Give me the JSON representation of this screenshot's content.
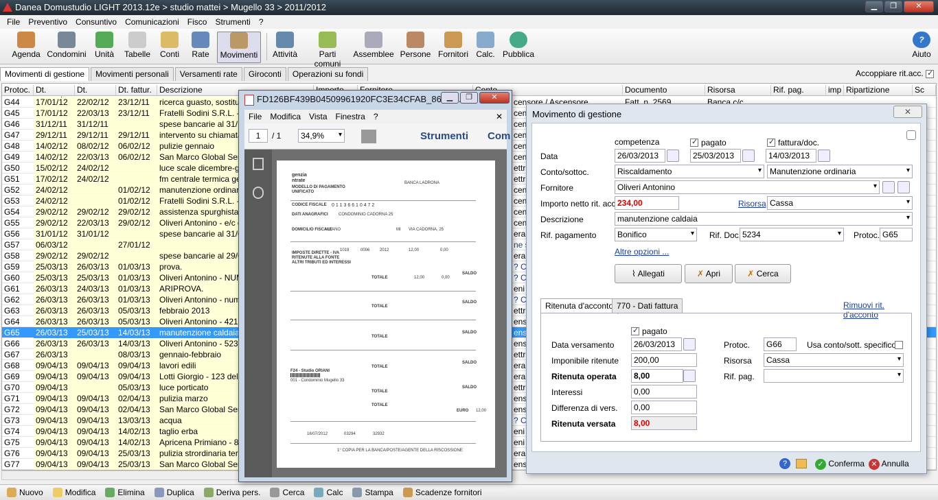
{
  "window": {
    "title": "Danea Domustudio LIGHT 2013.12e > studio mattei > Mugello 33 > 2011/2012",
    "min": "▁",
    "max": "❐",
    "close": "✕"
  },
  "menu": [
    "File",
    "Preventivo",
    "Consuntivo",
    "Comunicazioni",
    "Fisco",
    "Strumenti",
    "?"
  ],
  "toolbar": [
    "Agenda",
    "Condomini",
    "Unità",
    "Tabelle",
    "Conti",
    "Rate",
    "Movimenti",
    "Attività",
    "Parti comuni",
    "Assemblee",
    "Persone",
    "Fornitori",
    "Calc.",
    "Pubblica",
    "Aiuto"
  ],
  "tabs": [
    "Movimenti di gestione",
    "Movimenti personali",
    "Versamenti rate",
    "Giroconti",
    "Operazioni su fondi"
  ],
  "accoppiare": "Accoppiare rit.acc.",
  "grid": {
    "headers": [
      "Protoc.",
      "Dt. compet.",
      "Dt. pagam.",
      "Dt. fattur.",
      "Descrizione",
      "Importo",
      "Fornitore",
      "Conto",
      "Documento",
      "Risorsa",
      "Rif. pag.",
      "imp",
      "Ripartizione",
      "Sc"
    ],
    "rows": [
      [
        "G44",
        "17/01/12",
        "22/02/12",
        "23/12/11",
        "ricerca guasto, sostituito",
        "censore / Ascensore",
        "Fatt. n. 2569",
        "Banca c/c"
      ],
      [
        "G45",
        "17/01/12",
        "22/03/13",
        "23/12/11",
        "Fratelli Sodini S.R.L. - Fa",
        "censi",
        "",
        ""
      ],
      [
        "G46",
        "31/12/11",
        "31/12/11",
        "",
        "spese bancarie al 31/12",
        "censi",
        "",
        ""
      ],
      [
        "G47",
        "29/12/11",
        "29/12/11",
        "29/12/11",
        "intervento su chiamata d",
        "censi",
        "",
        ""
      ],
      [
        "G48",
        "14/02/12",
        "08/02/12",
        "06/02/12",
        "pulizie gennaio",
        "censi",
        "",
        ""
      ],
      [
        "G49",
        "14/02/12",
        "22/03/13",
        "06/02/12",
        "San Marco Global Servic",
        "censi",
        "",
        ""
      ],
      [
        "G50",
        "15/02/12",
        "24/02/12",
        "",
        "luce scale dicembre-gen",
        "ettric",
        "",
        ""
      ],
      [
        "G51",
        "17/02/12",
        "24/02/12",
        "",
        "fm centrale termica genn",
        "ettric",
        "",
        ""
      ],
      [
        "G52",
        "24/02/12",
        "",
        "01/02/12",
        "manutenzione ordinaria,",
        "censi",
        "",
        ""
      ],
      [
        "G53",
        "24/02/12",
        "",
        "01/02/12",
        "Fratelli Sodini S.R.L. - Fa",
        "censi",
        "",
        ""
      ],
      [
        "G54",
        "29/02/12",
        "29/02/12",
        "29/02/12",
        "assistenza spurghista pe",
        "censi",
        "",
        ""
      ],
      [
        "G55",
        "29/02/12",
        "22/03/13",
        "29/02/12",
        "Oliveri Antonino - e/c de",
        "censi",
        "",
        ""
      ],
      [
        "G56",
        "31/01/12",
        "31/01/12",
        "",
        "spese bancarie al 31/01",
        "erali",
        "",
        ""
      ],
      [
        "G57",
        "06/03/12",
        "",
        "27/01/12",
        "",
        "ne sp",
        "",
        ""
      ],
      [
        "G58",
        "29/02/12",
        "29/02/12",
        "",
        "spese bancarie al 29/02",
        "erali",
        "",
        ""
      ],
      [
        "G59",
        "25/03/13",
        "26/03/13",
        "01/03/13",
        "prova.",
        "? Co",
        "",
        ""
      ],
      [
        "G60",
        "25/03/13",
        "25/03/13",
        "01/03/13",
        "Oliveri Antonino - NUME",
        "? Co",
        "",
        ""
      ],
      [
        "G61",
        "26/03/13",
        "24/03/13",
        "01/03/13",
        "ARIPROVA.",
        "eni /",
        "",
        ""
      ],
      [
        "G62",
        "26/03/13",
        "26/03/13",
        "01/03/13",
        "Oliveri Antonino - numero",
        "? Co",
        "",
        ""
      ],
      [
        "G63",
        "26/03/13",
        "26/03/13",
        "05/03/13",
        "febbraio 2013",
        "ettric",
        "",
        ""
      ],
      [
        "G64",
        "26/03/13",
        "26/03/13",
        "05/03/13",
        "Oliveri Antonino - 4215 d",
        "ensi",
        "",
        ""
      ],
      [
        "G65",
        "26/03/13",
        "25/03/13",
        "14/03/13",
        "manutenzione caldaia",
        "ensi",
        "",
        ""
      ],
      [
        "G66",
        "26/03/13",
        "26/03/13",
        "14/03/13",
        "Oliveri Antonino - 5234 d",
        "ensi",
        "",
        ""
      ],
      [
        "G67",
        "26/03/13",
        "",
        "08/03/13",
        "gennaio-febbraio",
        "ettric",
        "",
        ""
      ],
      [
        "G68",
        "09/04/13",
        "09/04/13",
        "09/04/13",
        "lavori edili",
        "erali",
        "",
        ""
      ],
      [
        "G69",
        "09/04/13",
        "09/04/13",
        "09/04/13",
        "Lotti Giorgio - 123 del 09",
        "erali",
        "",
        ""
      ],
      [
        "G70",
        "09/04/13",
        "",
        "05/03/13",
        "luce porticato",
        "ettric",
        "",
        ""
      ],
      [
        "G71",
        "09/04/13",
        "09/04/13",
        "02/04/13",
        "pulizia marzo",
        "ensi",
        "",
        ""
      ],
      [
        "G72",
        "09/04/13",
        "09/04/13",
        "02/04/13",
        "San Marco Global Servic",
        "ensi",
        "",
        ""
      ],
      [
        "G73",
        "09/04/13",
        "09/04/13",
        "13/03/13",
        "acqua",
        "? Co",
        "",
        ""
      ],
      [
        "G74",
        "09/04/13",
        "09/04/13",
        "14/02/13",
        "taglio erba",
        "eni /",
        "",
        ""
      ],
      [
        "G75",
        "09/04/13",
        "09/04/13",
        "14/02/13",
        "Apricena Primiano - 8524",
        "eni /",
        "",
        ""
      ],
      [
        "G76",
        "09/04/13",
        "09/04/13",
        "25/03/13",
        "pulizia strordinaria terraz",
        "erali",
        "",
        ""
      ],
      [
        "G77",
        "09/04/13",
        "09/04/13",
        "25/03/13",
        "San Marco Global Servic",
        "ensi",
        "",
        ""
      ]
    ]
  },
  "bottombar": [
    "Nuovo",
    "Modifica",
    "Elimina",
    "Duplica",
    "Deriva pers.",
    "Cerca",
    "Calc",
    "Stampa",
    "Scadenze fornitori"
  ],
  "pdf": {
    "title": "FD126BF439B04509961920FC3E34CFAB_865.P...",
    "menu": [
      "File",
      "Modifica",
      "Vista",
      "Finestra",
      "?"
    ],
    "page": "1",
    "pages": "/ 1",
    "zoom": "34,9%",
    "strumenti": "Strumenti",
    "com": "Com",
    "doc": {
      "agenzia": "genzia",
      "entrate": "ntrate",
      "modello": "MODELLO DI PAGAMENTO",
      "unificato": "UNIFICATO",
      "banca": "BANCA LADRONA",
      "cf_label": "CODICE FISCALE",
      "cf": "0 1 1 3 6 6 1 0 4 7 2",
      "anag": "DATI ANAGRAFICI",
      "cond": "CONDOMINIO CADORNA 25",
      "dom": "DOMICILIO FISCALE",
      "citta": "MILANO",
      "prov": "MI",
      "via": "VIA CADORNA, 25",
      "imposte": "IMPOSTE DIRETTE - IVA",
      "ritenute": "RITENUTE ALLA FONTE",
      "altri": "ALTRI TRIBUTI ED INTERESSI",
      "codtrib": "1019",
      "anno": "2012",
      "rif": "0006",
      "importo": "12,00",
      "zero": "0,00",
      "saldo": "SALDO",
      "totale": "TOTALE",
      "f24": "F24 - Studio ORIANI",
      "cond2": "001 - Condominio Mugello 33",
      "euro": "EURO",
      "copia": "1° COPIA PER LA BANCA/POSTE/AGENTE DELLA RISCOSSIONE",
      "data": "16/07/2012",
      "n1": "03294",
      "n2": "32932"
    }
  },
  "dialog": {
    "title": "Movimento di gestione",
    "close": "✕",
    "competenza": "competenza",
    "pagato": "pagato",
    "fattura": "fattura/doc.",
    "data_label": "Data",
    "data_comp": "26/03/2013",
    "data_pag": "25/03/2013",
    "data_fatt": "14/03/2013",
    "conto_label": "Conto/sottoc.",
    "conto": "Riscaldamento",
    "sottoconto": "Manutenzione ordinaria",
    "fornitore_label": "Fornitore",
    "fornitore": "Oliveri Antonino",
    "importo_label": "Importo netto rit. acc.",
    "importo": "234,00",
    "risorsa_link": "Risorsa",
    "risorsa": "Cassa",
    "descr_label": "Descrizione",
    "descr": "manutenzione caldaia",
    "rifpag_label": "Rif. pagamento",
    "rifpag": "Bonifico",
    "rifdoc_label": "Rif. Doc.",
    "rifdoc": "5234",
    "protoc_label": "Protoc.",
    "protoc": "G65",
    "altre": "Altre opzioni ...",
    "btn_allegati": "Allegati",
    "btn_apri": "Apri",
    "btn_cerca": "Cerca",
    "tab1": "Ritenuta d'acconto",
    "tab2": "770 - Dati fattura",
    "rimuovi": "Rimuovi rit. d'acconto",
    "rit": {
      "pagato": "pagato",
      "datavers_label": "Data versamento",
      "datavers": "26/03/2013",
      "protoc_label": "Protoc.",
      "protoc": "G66",
      "usa": "Usa conto/sott. specifico",
      "impon_label": "Imponibile ritenute",
      "impon": "200,00",
      "risorsa_label": "Risorsa",
      "risorsa": "Cassa",
      "operata_label": "Ritenuta operata",
      "operata": "8,00",
      "rifpag_label": "Rif. pag.",
      "interessi_label": "Interessi",
      "interessi": "0,00",
      "diff_label": "Differenza di vers.",
      "diff": "0,00",
      "versata_label": "Ritenuta versata",
      "versata": "8,00"
    },
    "conferma": "Conferma",
    "annulla": "Annulla"
  }
}
